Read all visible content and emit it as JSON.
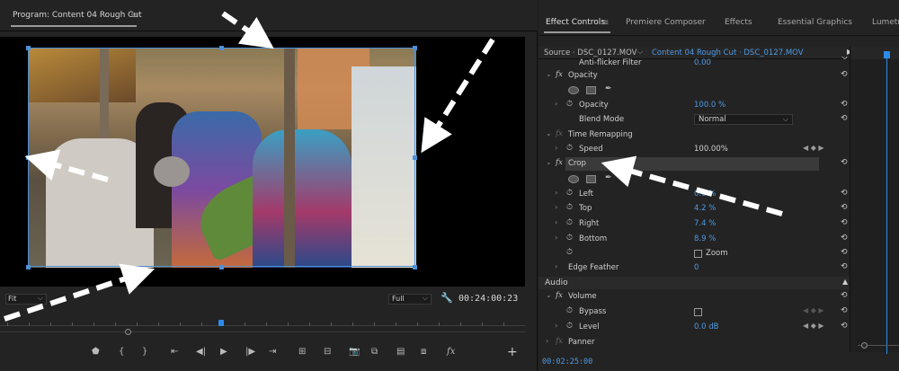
{
  "program": {
    "tab_title": "Program: Content 04 Rough Cut",
    "menu_glyph": "≡",
    "fit_value": "Fit",
    "full_value": "Full",
    "timecode": "00:24:00:23"
  },
  "effect_controls": {
    "tabs": [
      {
        "label": "Effect Controls",
        "active": true
      },
      {
        "label": "Premiere Composer",
        "active": false
      },
      {
        "label": "Effects",
        "active": false
      },
      {
        "label": "Essential Graphics",
        "active": false
      },
      {
        "label": "Lumetri",
        "active": false
      }
    ],
    "tab_menu": "≡",
    "source_label": "Source · DSC_0127.MOV",
    "clip_label": "Content 04 Rough Cut · DSC_0127.MOV",
    "anti_flicker": "Anti-flicker Filter",
    "anti_flicker_val": "0.00",
    "opacity": {
      "name": "Opacity",
      "prop": "Opacity",
      "value": "100.0 %",
      "blend_label": "Blend Mode",
      "blend_value": "Normal"
    },
    "time_remap": {
      "name": "Time Remapping",
      "speed_label": "Speed",
      "speed_value": "100.00%"
    },
    "crop": {
      "name": "Crop",
      "left_label": "Left",
      "left_value": "0.0 %",
      "top_label": "Top",
      "top_value": "4.2 %",
      "right_label": "Right",
      "right_value": "7.4 %",
      "bottom_label": "Bottom",
      "bottom_value": "8.9 %",
      "zoom_label": "Zoom",
      "feather_label": "Edge Feather",
      "feather_value": "0"
    },
    "audio_header": "Audio",
    "volume": {
      "name": "Volume",
      "bypass_label": "Bypass",
      "level_label": "Level",
      "level_value": "0.0 dB"
    },
    "panner": "Panner",
    "bottom_timecode": "00:02:25:00"
  },
  "colors": {
    "accent_blue": "#4f9ae6",
    "playhead": "#2d8ceb",
    "panel_bg": "#232323",
    "annotation": "#ffffff"
  },
  "icons": [
    "menu-icon",
    "wrench-icon",
    "stopwatch-icon",
    "reset-icon",
    "keyframe-icon",
    "pen-mask-icon",
    "ellipse-mask-icon",
    "rect-mask-icon",
    "play-icon",
    "step-back-icon",
    "step-forward-icon",
    "marker-icon",
    "export-frame-icon",
    "add-button-icon"
  ]
}
